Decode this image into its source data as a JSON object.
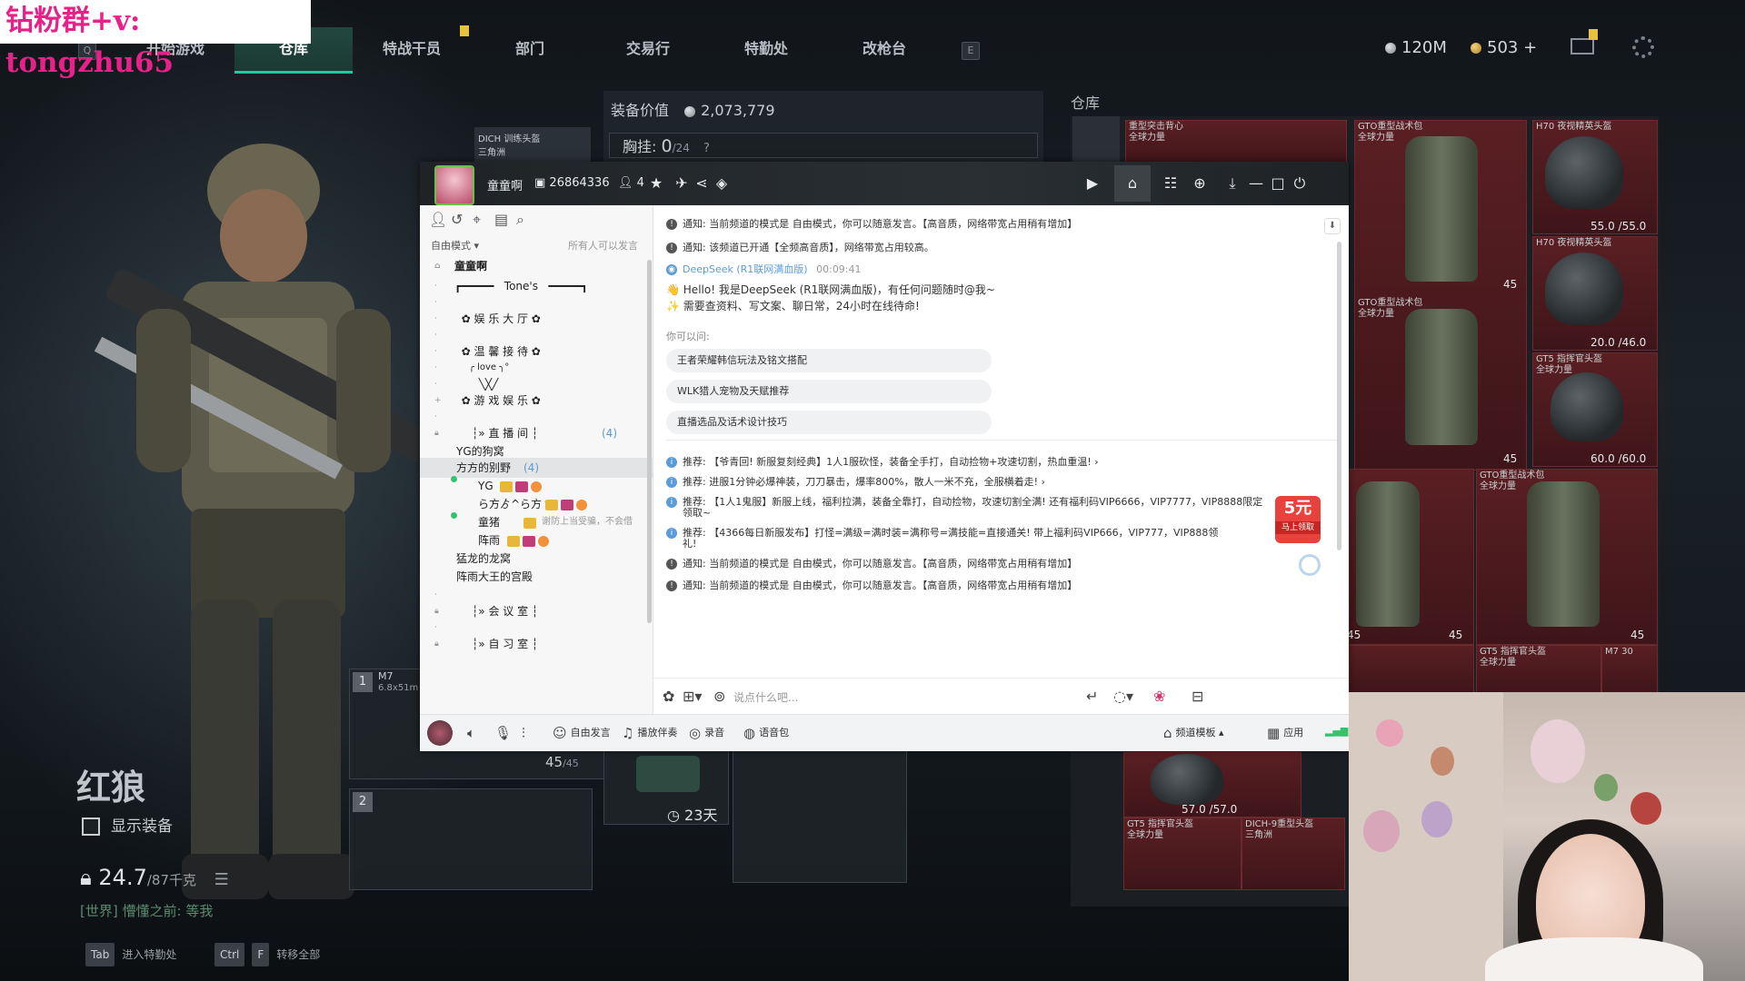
{
  "watermark": "钻粉群+v: tongzhu65",
  "nav": {
    "key_left": "Q",
    "key_right": "E",
    "tabs": [
      "开始游戏",
      "仓库",
      "特战干员",
      "部门",
      "交易行",
      "特勤处",
      "改枪台"
    ],
    "active": "仓库"
  },
  "currency": {
    "silver": "120M",
    "gold": "503 +"
  },
  "equip_panel": {
    "helmet_label": "DICH 训练头盔\n三角洲",
    "value_label": "装备价值",
    "value": "2,073,779",
    "chest_label": "胸挂:",
    "chest_value": "0",
    "chest_max": "/24",
    "chest_help": "?"
  },
  "warehouse": {
    "title": "仓库",
    "items": [
      {
        "name": "重型突击背心\n全球力量"
      },
      {
        "name": "GTO重型战术包\n全球力量"
      },
      {
        "name": "H70 夜视精英头盔",
        "durability": "55.0 /55.0"
      },
      {
        "name": "H70 夜视精英头盔",
        "durability": "20.0 /46.0"
      },
      {
        "name": "GTO重型战术包\n全球力量"
      },
      {
        "name": "GT5 指挥官头盔\n全球力量",
        "durability": "60.0 /60.0"
      },
      {
        "name": "GTO重型战术包\n全球力量"
      },
      {
        "name": "GT5 指挥官头盔\n全球力量"
      },
      {
        "name": "M7 30"
      },
      {
        "name": "GT5 指挥官头盔\n全球力量"
      },
      {
        "name": "DICH-9重型头盔\n三角洲"
      }
    ],
    "counts": [
      "45",
      "45",
      "45",
      "45",
      "45"
    ],
    "helmet_dur": "57.0 /57.0"
  },
  "character": {
    "name": "红狼",
    "show_equip": "显示装备",
    "weight": "24.7",
    "weight_max": "/87千克",
    "world_chat_tag": "[世界]",
    "world_chat_text": "懵懂之前: 等我"
  },
  "hints": [
    {
      "key": "Tab",
      "label": "进入特勤处"
    },
    {
      "key": "Ctrl",
      "key2": "F",
      "label": "转移全部"
    }
  ],
  "weapons": {
    "slot1_num": "1",
    "slot1_name": "M7",
    "slot1_sub": "6.8x51m",
    "slot2_num": "2",
    "ammo": "45",
    "ammo_max": "/45",
    "case_timer": "23天"
  },
  "chat_window": {
    "title": "童童啊",
    "room_id": "26864336",
    "user_count": "4",
    "left": {
      "mode": "自由模式 ▾",
      "mode_right": "所有人可以发言",
      "channel_title": "童童啊",
      "rows": [
        "┏━━━━━   Tone's   ━━━━━┓",
        "",
        "  ✿ 娱 乐 大 厅 ✿",
        "",
        "  ✿ 温 馨 接 待 ✿",
        "     ╭ love ╮°",
        "       ╲╳╱",
        "  ✿ 游 戏 娱 乐 ✿",
        "",
        "     ┆» 直 播 间 ┆"
      ],
      "live_count": "(4)",
      "sub_rooms": [
        "YG的狗窝",
        "方方的别野"
      ],
      "sub_count": "(4)",
      "members": [
        "YG",
        "ら方ゟ^ら方ゞ",
        "童猪",
        "阵雨"
      ],
      "member_status": "谢防上当受骗，不会借",
      "rooms": [
        "猛龙的龙窝",
        "阵雨大王的宫殿"
      ],
      "rows2": [
        "",
        "     ┆» 会 议 室 ┆",
        "",
        "     ┆» 自 习 室 ┆"
      ]
    },
    "messages": {
      "notice1": "通知: 当前频道的模式是 自由模式，你可以随意发言。【高音质，网络带宽占用稍有增加】",
      "notice2": "通知: 该频道已开通【全频高音质】，网络带宽占用较高。",
      "bot_name": "DeepSeek (R1联网满血版)",
      "bot_time": "00:09:41",
      "bot_line1": "Hello! 我是DeepSeek (R1联网满血版)，有任何问题随时@我~",
      "bot_line2": "需要查资料、写文案、聊日常，24小时在线待命!",
      "ask_label": "你可以问:",
      "suggestions": [
        "王者荣耀韩信玩法及铭文搭配",
        "WLK猎人宠物及天赋推荐",
        "直播选品及话术设计技巧"
      ],
      "rec1": "推荐: 【爷青回! 新服复刻经典】1人1服砍怪，装备全手打，自动捡物+攻速切割，热血重温!  ›",
      "rec2": "推荐: 进服1分钟必爆神装，刀刀暴击，爆率800%，散人一米不充，全服横着走!  ›",
      "rec3": "推荐: 【1人1鬼服】新服上线，福利拉满，装备全靠打，自动捡物，攻速切割全满! 还有福利码VIP6666，VIP7777，VIP8888限定",
      "rec3b": "领取~",
      "rec4": "推荐: 【4366每日新服发布】打怪=满级=满时装=满称号=满技能=直接通关! 带上福利码VIP666，VIP777，VIP888领",
      "rec4b": "礼!",
      "notice3": "通知: 当前频道的模式是 自由模式，你可以随意发言。【高音质，网络带宽占用稍有增加】",
      "notice4": "通知: 当前频道的模式是 自由模式，你可以随意发言。【高音质，网络带宽占用稍有增加】",
      "promo_big": "5元",
      "promo_small": "马上领取"
    },
    "input_placeholder": "说点什么吧...",
    "bottom": {
      "free_speak": "自由发言",
      "play_music": "播放伴奏",
      "record": "录音",
      "voice_pack": "语音包",
      "template": "频道模板",
      "apps": "应用"
    }
  }
}
